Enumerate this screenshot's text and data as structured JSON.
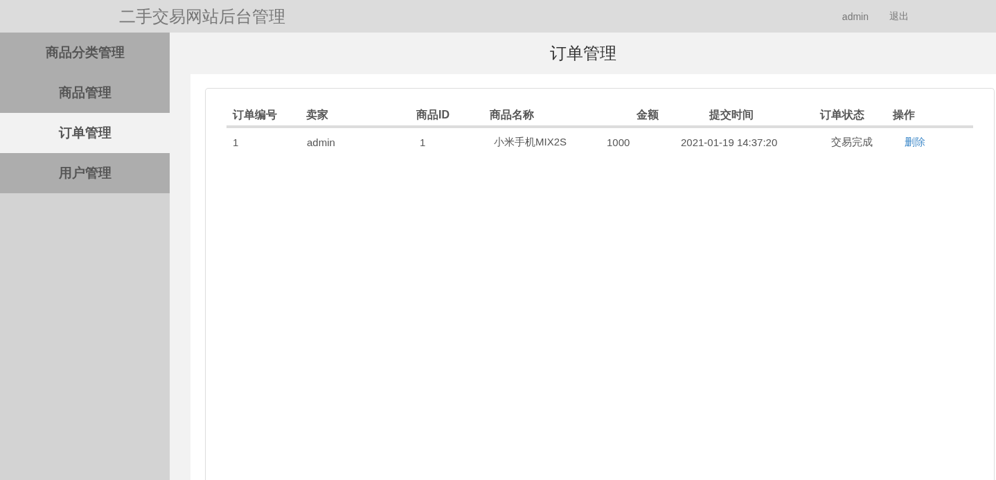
{
  "header": {
    "title": "二手交易网站后台管理",
    "user": "admin",
    "logout": "退出"
  },
  "sidebar": {
    "items": [
      {
        "label": "商品分类管理",
        "selected": false
      },
      {
        "label": "商品管理",
        "selected": false
      },
      {
        "label": "订单管理",
        "selected": true
      },
      {
        "label": "用户管理",
        "selected": false
      }
    ]
  },
  "page_title": "订单管理",
  "table": {
    "columns": [
      "订单编号",
      "卖家",
      "商品ID",
      "商品名称",
      "金额",
      "提交时间",
      "订单状态",
      "操作"
    ],
    "rows": [
      {
        "cells": [
          "1",
          "admin",
          "1",
          "小米手机MIX2S",
          "1000",
          "2021-01-19 14:37:20",
          "交易完成"
        ],
        "action": "删除"
      }
    ]
  }
}
